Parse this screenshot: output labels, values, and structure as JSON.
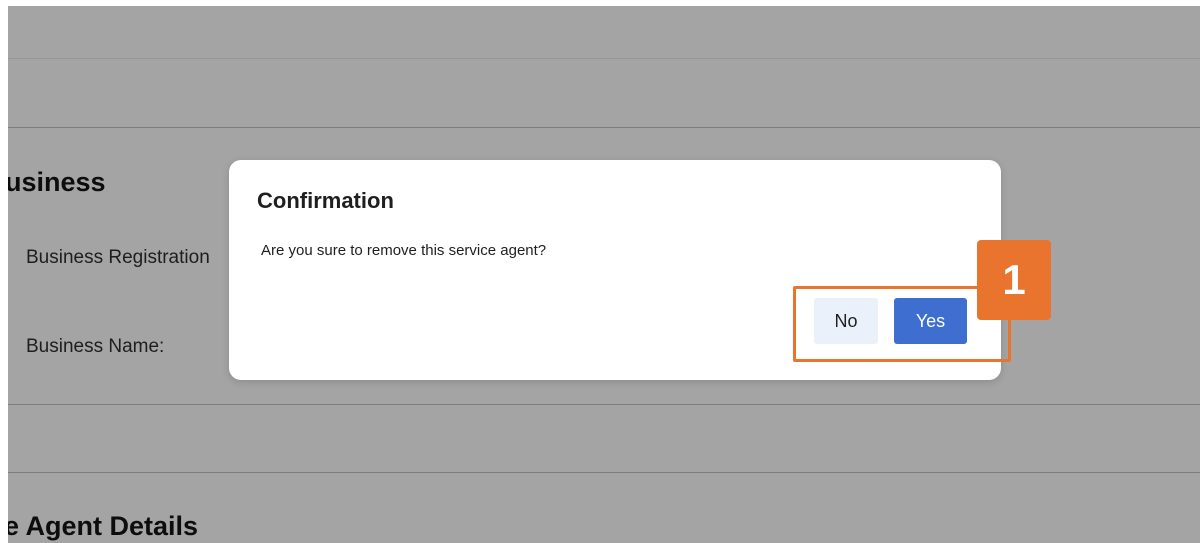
{
  "background_page": {
    "business_section": {
      "heading": "usiness",
      "fields": [
        {
          "label": "Business Registration"
        },
        {
          "label": "Business Name:"
        }
      ]
    },
    "agent_section": {
      "heading": "e Agent Details"
    }
  },
  "dialog": {
    "title": "Confirmation",
    "message": "Are you sure to remove this service agent?",
    "no_label": "No",
    "yes_label": "Yes"
  },
  "annotation": {
    "step_number": "1",
    "color": "#e8742e"
  },
  "colors": {
    "overlay": "#a4a4a4",
    "primary_button": "#3e6fd0",
    "secondary_button": "#eaf1fb"
  }
}
